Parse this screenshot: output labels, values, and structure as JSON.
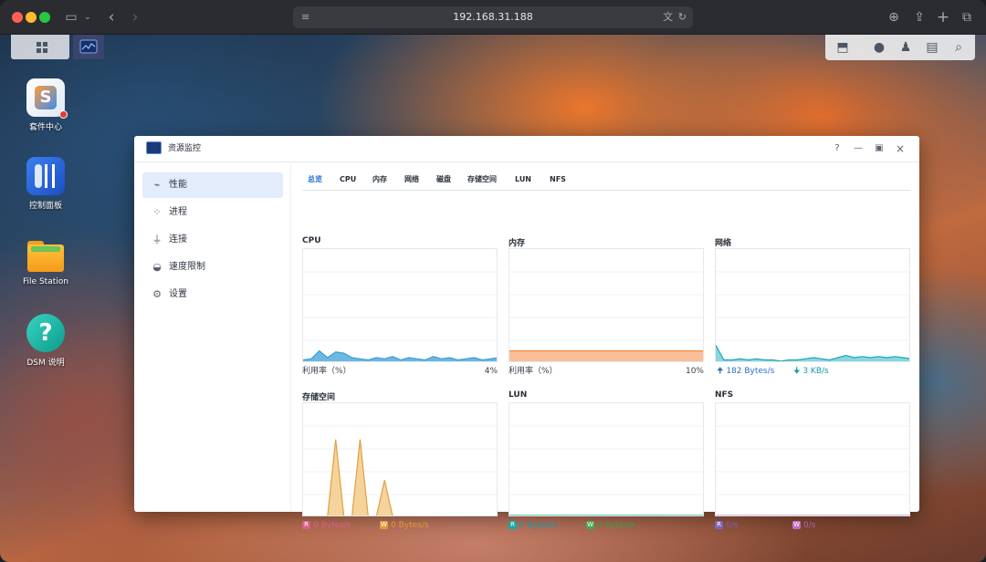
{
  "browser": {
    "url": "192.168.31.188"
  },
  "desktop": {
    "icons": [
      {
        "label": "套件中心",
        "icon": "package-center-icon"
      },
      {
        "label": "控制面板",
        "icon": "control-panel-icon"
      },
      {
        "label": "File Station",
        "icon": "folder-icon"
      },
      {
        "label": "DSM 说明",
        "icon": "help-icon"
      }
    ]
  },
  "window": {
    "title": "资源监控",
    "sidebar": [
      {
        "label": "性能",
        "icon": "performance-icon",
        "active": true
      },
      {
        "label": "进程",
        "icon": "process-icon"
      },
      {
        "label": "连接",
        "icon": "plug-icon"
      },
      {
        "label": "速度限制",
        "icon": "speed-limit-icon"
      },
      {
        "label": "设置",
        "icon": "gear-icon"
      }
    ],
    "tabs": [
      "总览",
      "CPU",
      "内存",
      "网络",
      "磁盘",
      "存储空间",
      "LUN",
      "NFS"
    ],
    "active_tab": "总览",
    "panels": {
      "cpu": {
        "title": "CPU",
        "foot_label": "利用率（%）",
        "foot_value": "4%"
      },
      "memory": {
        "title": "内存",
        "foot_label": "利用率（%）",
        "foot_value": "10%"
      },
      "network": {
        "title": "网络",
        "up": "182 Bytes/s",
        "down": "3 KB/s"
      },
      "volume": {
        "title": "存储空间",
        "r_badge": "R",
        "r": "0 Bytes/s",
        "w_badge": "W",
        "w": "0 Bytes/s"
      },
      "lun": {
        "title": "LUN",
        "r_badge": "R",
        "r": "0 Bytes/s",
        "w_badge": "W",
        "w": "0 Bytes/s"
      },
      "nfs": {
        "title": "NFS",
        "r_badge": "R",
        "r": "0/s",
        "w_badge": "W",
        "w": "0/s"
      }
    }
  },
  "chart_data": [
    {
      "type": "area",
      "panel": "CPU",
      "ylim": [
        0,
        100
      ],
      "values": [
        2,
        3,
        10,
        4,
        9,
        8,
        4,
        3,
        2,
        4,
        3,
        5,
        2,
        4,
        3,
        2,
        5,
        3,
        4,
        2,
        3,
        4,
        2,
        3,
        4
      ]
    },
    {
      "type": "area",
      "panel": "内存",
      "ylim": [
        0,
        100
      ],
      "values": [
        10,
        10,
        10,
        10,
        10,
        10,
        10,
        10,
        10,
        10,
        10,
        10,
        10,
        10,
        10,
        10,
        10,
        10,
        10,
        10,
        10,
        10,
        10,
        10,
        10
      ]
    },
    {
      "type": "area",
      "panel": "网络",
      "series": [
        {
          "values": [
            15,
            2,
            2,
            3,
            2,
            3,
            2,
            2,
            1,
            2,
            2,
            3,
            4,
            3,
            2,
            4,
            6,
            4,
            5,
            4,
            5,
            4,
            5,
            4,
            3
          ]
        }
      ]
    },
    {
      "type": "area",
      "panel": "存储空间",
      "values": [
        0,
        0,
        0,
        0,
        68,
        0,
        0,
        68,
        0,
        0,
        32,
        0,
        0,
        0,
        0,
        0,
        0,
        0,
        0,
        0,
        0,
        0,
        0,
        0,
        0
      ]
    }
  ],
  "colors": {
    "accent": "#1f6fd1",
    "cpu": "#3aa0d8",
    "memory": "#f28a3a",
    "network": "#18a8b8",
    "read": "#d9608a",
    "write": "#e49a3a"
  }
}
